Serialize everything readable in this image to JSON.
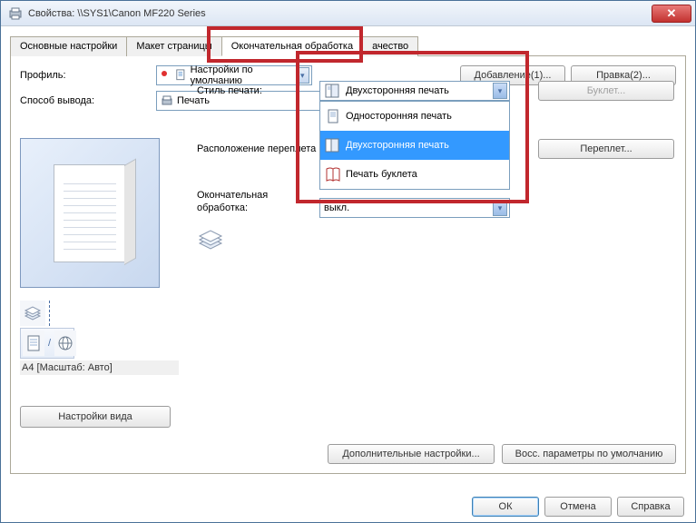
{
  "window": {
    "title": "Свойства: \\\\SYS1\\Canon MF220 Series"
  },
  "tabs": {
    "basic": "Основные настройки",
    "page": "Макет страницы",
    "finishing": "Окончательная обработка",
    "quality": "ачество"
  },
  "profile": {
    "label": "Профиль:",
    "value": "Настройки по умолчанию",
    "add_btn": "Добавление(1)...",
    "edit_btn": "Правка(2)..."
  },
  "output": {
    "label": "Способ вывода:",
    "value": "Печать"
  },
  "preview": {
    "info": "A4 [Масштаб: Авто]",
    "view_btn": "Настройки вида"
  },
  "print_style": {
    "label": "Стиль печати:",
    "value": "Двухсторонняя печать",
    "options": {
      "one": "Односторонняя печать",
      "duplex": "Двухсторонняя печать",
      "booklet": "Печать буклета"
    },
    "booklet_btn": "Буклет..."
  },
  "binding": {
    "label": "Расположение переплета",
    "binding_btn": "Переплет..."
  },
  "finishing_field": {
    "label": "Окончательная обработка:",
    "value": "выкл."
  },
  "bottom": {
    "advanced": "Дополнительные настройки...",
    "restore": "Восс. параметры по умолчанию"
  },
  "dialog": {
    "ok": "ОК",
    "cancel": "Отмена",
    "help": "Справка"
  }
}
